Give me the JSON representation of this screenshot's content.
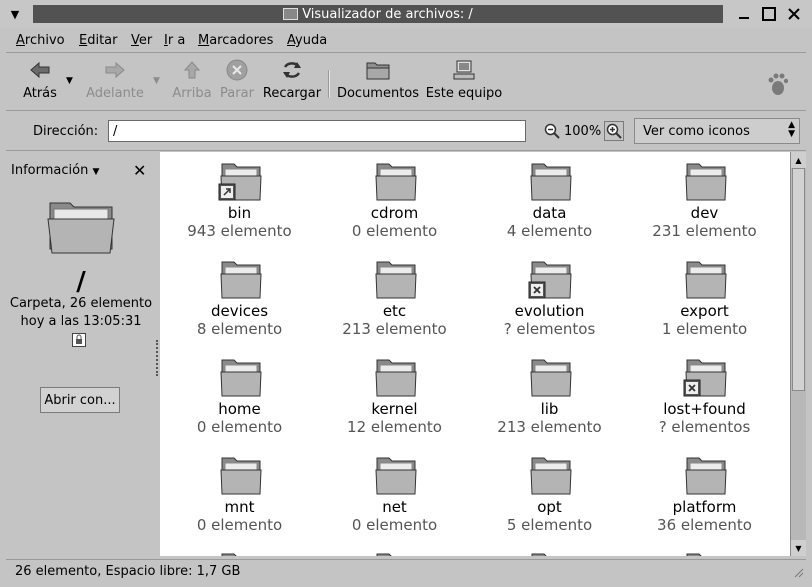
{
  "window": {
    "title": "Visualizador de archivos: /",
    "minimize_glyph": "▁",
    "maximize_glyph": "☐",
    "close_glyph": "✕",
    "menu_glyph": "▼"
  },
  "menubar": {
    "items": [
      {
        "mnemonic": "A",
        "rest": "rchivo"
      },
      {
        "mnemonic": "E",
        "rest": "ditar"
      },
      {
        "mnemonic": "V",
        "rest": "er"
      },
      {
        "mnemonic": "I",
        "rest": "r a"
      },
      {
        "mnemonic": "M",
        "rest": "arcadores"
      },
      {
        "mnemonic": "A",
        "rest": "yuda"
      }
    ]
  },
  "toolbar": {
    "back": "Atrás",
    "forward": "Adelante",
    "up": "Arriba",
    "stop": "Parar",
    "reload": "Recargar",
    "documents": "Documentos",
    "computer": "Este equipo"
  },
  "location": {
    "label": "Dirección:",
    "value": "/",
    "zoom": "100%",
    "view_mode": "Ver como iconos"
  },
  "sidepane": {
    "title": "Información",
    "folder_name": "/",
    "info_line1": "Carpeta, 26 elemento",
    "info_line2": "hoy a las 13:05:31",
    "open_with": "Abrir con..."
  },
  "items": [
    {
      "name": "bin",
      "count": "943 elemento",
      "emblem": "link"
    },
    {
      "name": "cdrom",
      "count": "0 elemento",
      "emblem": ""
    },
    {
      "name": "data",
      "count": "4 elemento",
      "emblem": ""
    },
    {
      "name": "dev",
      "count": "231 elemento",
      "emblem": ""
    },
    {
      "name": "devices",
      "count": "8 elemento",
      "emblem": ""
    },
    {
      "name": "etc",
      "count": "213 elemento",
      "emblem": ""
    },
    {
      "name": "evolution",
      "count": "? elementos",
      "emblem": "noread"
    },
    {
      "name": "export",
      "count": "1 elemento",
      "emblem": ""
    },
    {
      "name": "home",
      "count": "0 elemento",
      "emblem": ""
    },
    {
      "name": "kernel",
      "count": "12 elemento",
      "emblem": ""
    },
    {
      "name": "lib",
      "count": "213 elemento",
      "emblem": ""
    },
    {
      "name": "lost+found",
      "count": "? elementos",
      "emblem": "noread"
    },
    {
      "name": "mnt",
      "count": "0 elemento",
      "emblem": ""
    },
    {
      "name": "net",
      "count": "0 elemento",
      "emblem": ""
    },
    {
      "name": "opt",
      "count": "5 elemento",
      "emblem": ""
    },
    {
      "name": "platform",
      "count": "36 elemento",
      "emblem": ""
    }
  ],
  "statusbar": {
    "text": "26 elemento, Espacio libre: 1,7 GB"
  },
  "scrollbar": {
    "position_fraction": 0.0,
    "visible_fraction": 0.6
  }
}
